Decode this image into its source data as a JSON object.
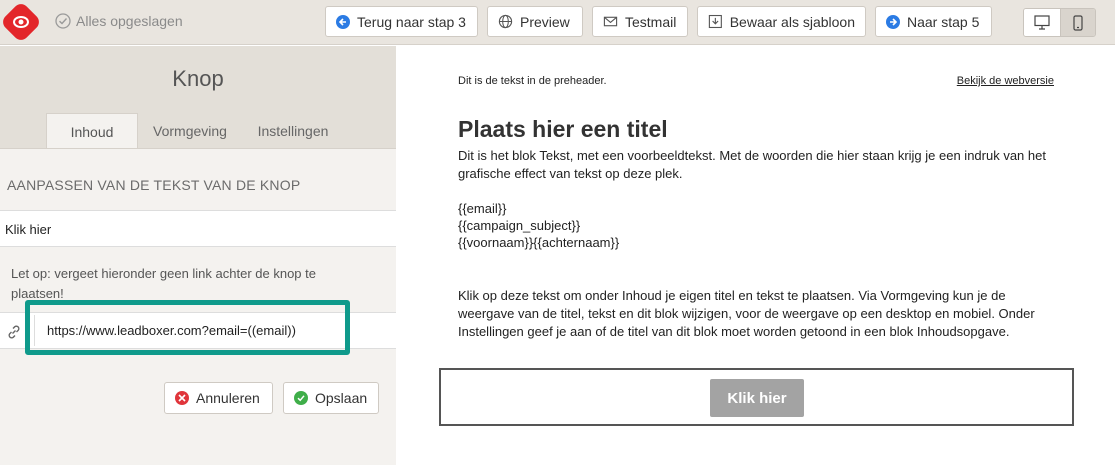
{
  "topbar": {
    "saved_status": "Alles opgeslagen",
    "buttons": {
      "back": "Terug naar stap 3",
      "preview": "Preview",
      "testmail": "Testmail",
      "save_template": "Bewaar als sjabloon",
      "next": "Naar stap 5"
    },
    "view_modes": [
      "desktop-icon",
      "mobile-icon"
    ],
    "active_view": "mobile"
  },
  "panel": {
    "title": "Knop",
    "tabs": [
      "Inhoud",
      "Vormgeving",
      "Instellingen"
    ],
    "active_tab": "Inhoud",
    "section_label": "AANPASSEN VAN DE TEKST VAN DE KNOP",
    "button_text_value": "Klik hier",
    "note": "Let op: vergeet hieronder geen link achter de knop te plaatsen!",
    "link_value": "https://www.leadboxer.com?email=((email))",
    "cancel_label": "Annuleren",
    "save_label": "Opslaan"
  },
  "email": {
    "preheader": "Dit is de tekst in de preheader.",
    "webversion_link": "Bekijk de webversie",
    "title": "Plaats hier een titel",
    "intro": "Dit is het blok Tekst, met een voorbeeldtekst. Met de woorden die hier staan krijg je een indruk van het grafische effect van tekst op deze plek.",
    "tags": [
      "{{email}}",
      "{{campaign_subject}}",
      "{{voornaam}}{{achternaam}}"
    ],
    "body": "Klik op deze tekst om onder Inhoud je eigen titel en tekst te plaatsen. Via Vormgeving kun je de weergave van de titel, tekst en dit blok wijzigen, voor de weergave op een desktop en mobiel. Onder Instellingen geef je aan of de titel van dit blok moet worden getoond in een blok Inhoudsopgave.",
    "button_label": "Klik hier"
  },
  "colors": {
    "brand_red": "#e3262a",
    "accent_blue": "#2b7be4",
    "highlight_teal": "#0f9a8b",
    "cancel_red": "#e0353b",
    "save_green": "#3fae49"
  }
}
